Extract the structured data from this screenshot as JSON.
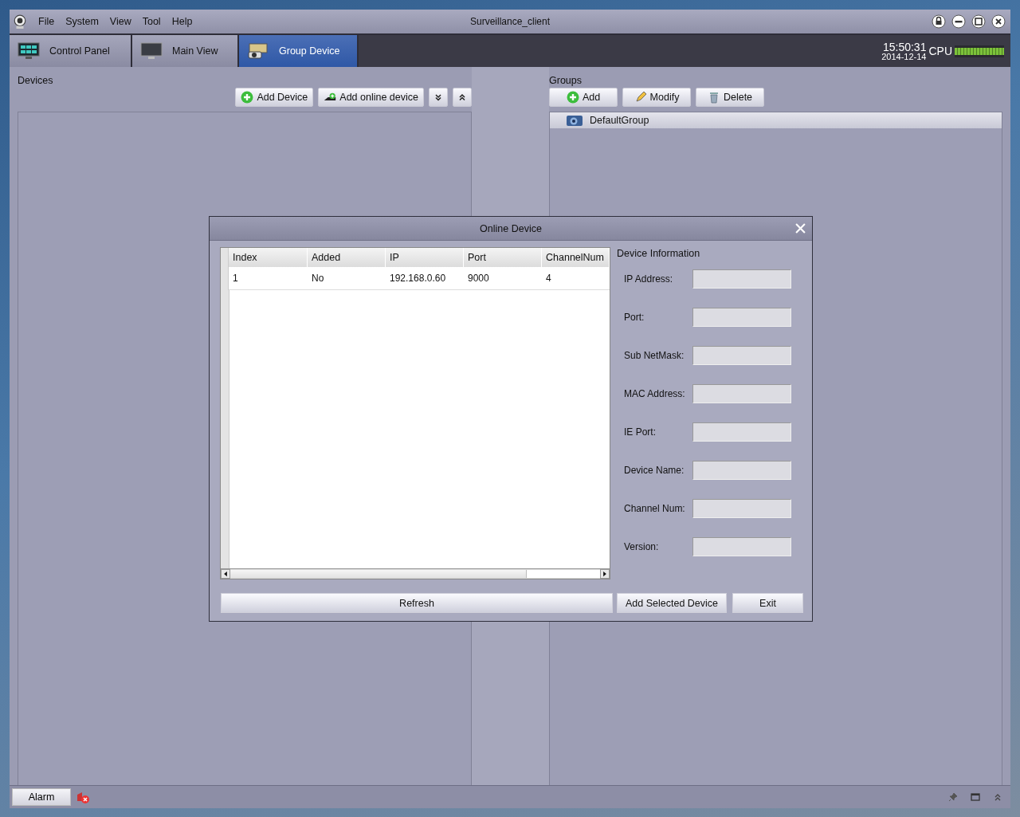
{
  "window": {
    "title": "Surveillance_client"
  },
  "menu": [
    "File",
    "System",
    "View",
    "Tool",
    "Help"
  ],
  "tabs": [
    {
      "label": "Control Panel",
      "kind": "panel",
      "selected": false
    },
    {
      "label": "Main View",
      "kind": "monitor",
      "selected": false
    },
    {
      "label": "Group Device",
      "kind": "camera",
      "selected": true
    }
  ],
  "clock": {
    "time": "15:50:31",
    "date": "2014-12-14"
  },
  "cpu": {
    "label": "CPU",
    "level": 1
  },
  "devices": {
    "title": "Devices",
    "buttons": [
      {
        "label": "Add Device",
        "kind": "add"
      },
      {
        "label": "Add online device",
        "kind": "online"
      },
      {
        "kind": "expand"
      },
      {
        "kind": "collapse"
      }
    ]
  },
  "groups": {
    "title": "Groups",
    "buttons": [
      {
        "label": "Add",
        "kind": "add"
      },
      {
        "label": "Modify",
        "kind": "modify"
      },
      {
        "label": "Delete",
        "kind": "delete"
      }
    ],
    "tree": [
      {
        "label": "DefaultGroup",
        "selected": true
      }
    ]
  },
  "dialog": {
    "title": "Online Device",
    "table": {
      "columns": [
        "Index",
        "Added",
        "IP",
        "Port",
        "ChannelNum"
      ],
      "rows": [
        [
          "1",
          "No",
          "192.168.0.60",
          "9000",
          "4"
        ]
      ]
    },
    "info_title": "Device Information",
    "fields": [
      "IP Address:",
      "Port:",
      "Sub NetMask:",
      "MAC Address:",
      "IE Port:",
      "Device Name:",
      "Channel Num:",
      "Version:"
    ],
    "buttons": [
      {
        "label": "Refresh",
        "kind": "wide"
      },
      {
        "label": "Add Selected Device",
        "kind": "normal"
      },
      {
        "label": "Exit",
        "kind": "normal"
      }
    ]
  },
  "status_bar": {
    "alarm": "Alarm"
  }
}
